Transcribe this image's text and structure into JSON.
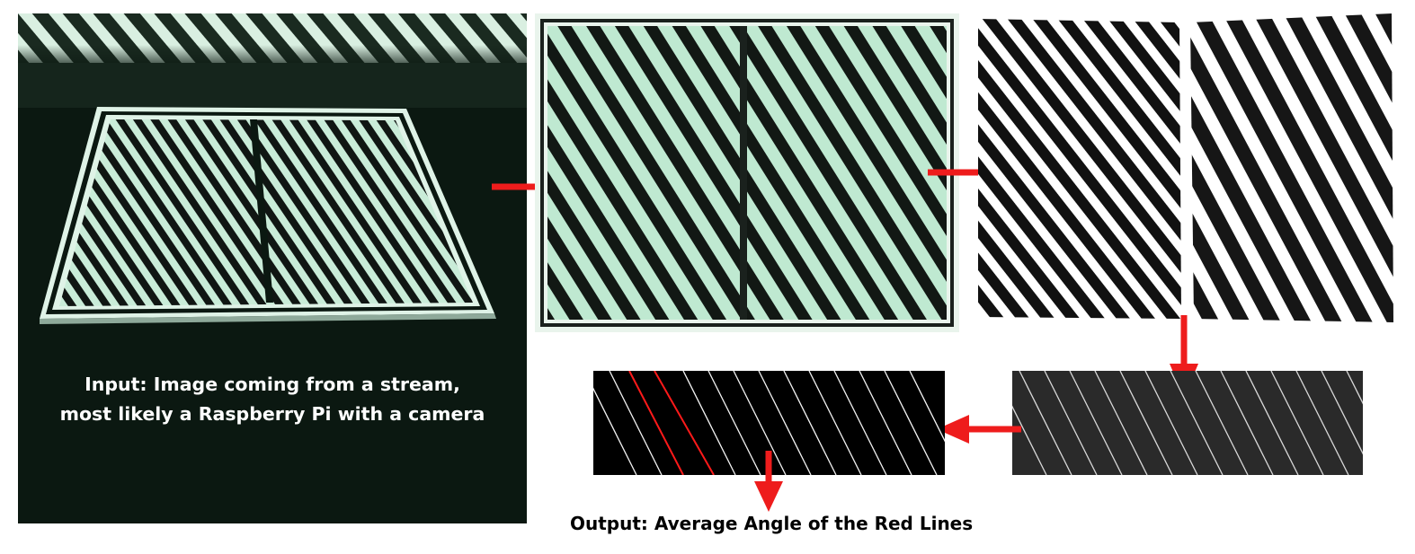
{
  "input_caption": {
    "line1": "Input: Image coming from a stream,",
    "line2": "most likely a Raspberry Pi with a camera"
  },
  "output_caption": "Output: Average Angle of the Red Lines",
  "colors": {
    "arrow": "#ee1c1c",
    "stripe_light": "#cfeedd",
    "stripe_dark": "#101613",
    "background_dark": "#0e1c14",
    "detected_line": "#ffffff",
    "selected_line": "#ff1a1a"
  },
  "stages": [
    "camera-input-photo",
    "cropped-warped-image",
    "binary-threshold-image",
    "edge-lines-image",
    "detected-lines-image"
  ]
}
